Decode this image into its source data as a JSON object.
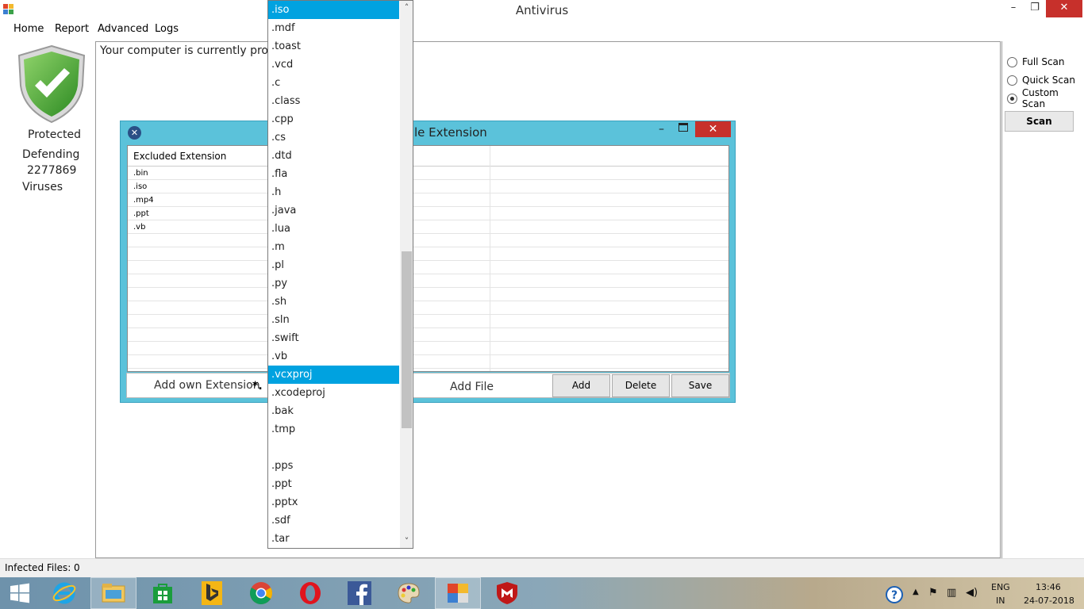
{
  "window": {
    "title": "Antivirus",
    "minimize": "–",
    "maximize": "❐",
    "close": "✕"
  },
  "menu": [
    "Home",
    "Report",
    "Advanced",
    "Logs"
  ],
  "left_panel": {
    "status": "Protected",
    "defending_label": "Defending",
    "virus_count": "2277869",
    "viruses_label": "Viruses"
  },
  "main": {
    "status_message": "Your computer is currently protected"
  },
  "scan_options": [
    {
      "label": "Full Scan",
      "checked": false
    },
    {
      "label": "Quick Scan",
      "checked": false
    },
    {
      "label": "Custom Scan",
      "checked": true
    }
  ],
  "scan_button": "Scan",
  "statusbar": {
    "infected_files": "Infected Files: 0"
  },
  "dialog": {
    "title_partial": "le Extension",
    "close_icon": "✕",
    "minimize_icon": "–",
    "grid_header": "Excluded Extension",
    "excluded": [
      ".bin",
      ".iso",
      ".mp4",
      ".ppt",
      ".vb"
    ],
    "add_own_label": "Add own Extension",
    "ext_prefix": "*.",
    "add_file_label": "Add File",
    "buttons": {
      "add": "Add",
      "delete": "Delete",
      "save": "Save"
    }
  },
  "dropdown": {
    "items": [
      ".iso",
      ".mdf",
      ".toast",
      ".vcd",
      ".c",
      ".class",
      ".cpp",
      ".cs",
      ".dtd",
      ".fla",
      ".h",
      ".java",
      ".lua",
      ".m",
      ".pl",
      ".py",
      ".sh",
      ".sln",
      ".swift",
      ".vb",
      ".vcxproj",
      ".xcodeproj",
      ".bak",
      ".tmp",
      "",
      ".pps",
      ".ppt",
      ".pptx",
      ".sdf",
      ".tar"
    ],
    "highlighted": [
      ".iso",
      ".vcxproj"
    ],
    "scroll_up": "˄",
    "scroll_down": "˅"
  },
  "taskbar": {
    "apps": [
      "windows-start",
      "internet-explorer",
      "file-explorer",
      "store",
      "bing",
      "chrome",
      "opera",
      "facebook",
      "paint",
      "antivirus-app",
      "mcafee"
    ],
    "active_app": "antivirus-app",
    "language": "ENG",
    "region": "IN",
    "time": "13:46",
    "date": "24-07-2018"
  },
  "colors": {
    "dialog_bg": "#5bc2da",
    "selection": "#00a2e0",
    "close_red": "#c7302b",
    "shield_green": "#3a9a2e"
  }
}
